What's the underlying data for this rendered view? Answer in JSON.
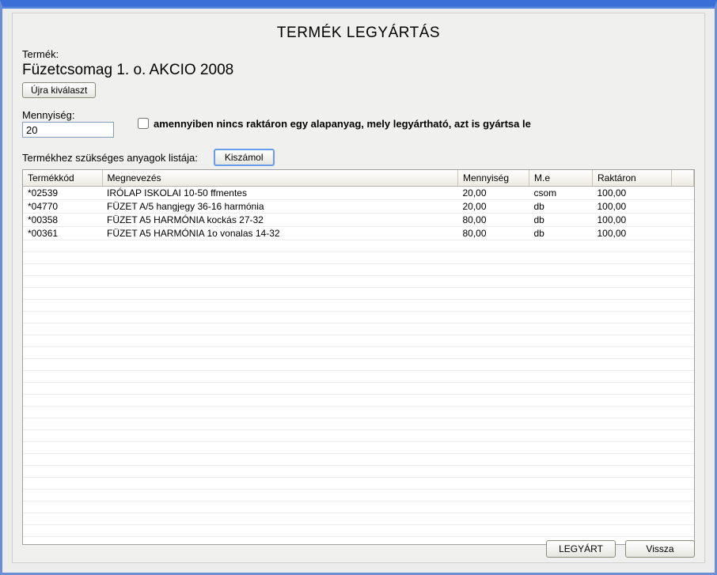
{
  "dialog": {
    "title": "TERMÉK LEGYÁRTÁS"
  },
  "labels": {
    "product": "Termék:",
    "quantity": "Mennyiség:",
    "materials_list": "Termékhez szükséges anyagok listája:"
  },
  "product": {
    "name": "Füzetcsomag  1. o.   AKCIO 2008"
  },
  "buttons": {
    "reselect": "Újra kiválaszt",
    "calculate": "Kiszámol",
    "produce": "LEGYÁRT",
    "back": "Vissza"
  },
  "quantity": {
    "value": "20"
  },
  "checkbox": {
    "label": "amennyiben nincs raktáron egy alapanyag, mely legyártható, azt is gyártsa le"
  },
  "grid": {
    "headers": {
      "code": "Termékkód",
      "name": "Megnevezés",
      "qty": "Mennyiség",
      "unit": "M.e",
      "stock": "Raktáron"
    },
    "rows": [
      {
        "code": "*02539",
        "name": "IRÓLAP ISKOLAI 10-50 ffmentes",
        "qty": "20,00",
        "unit": "csom",
        "stock": "100,00"
      },
      {
        "code": "*04770",
        "name": "FÜZET A/5  hangjegy   36-16  harmónia",
        "qty": "20,00",
        "unit": "db",
        "stock": "100,00"
      },
      {
        "code": "*00358",
        "name": "FÜZET A5  HARMÓNIA   kockás   27-32",
        "qty": "80,00",
        "unit": "db",
        "stock": "100,00"
      },
      {
        "code": "*00361",
        "name": "FÜZET A5  HARMÓNIA  1o vonalas   14-32",
        "qty": "80,00",
        "unit": "db",
        "stock": "100,00"
      }
    ]
  }
}
